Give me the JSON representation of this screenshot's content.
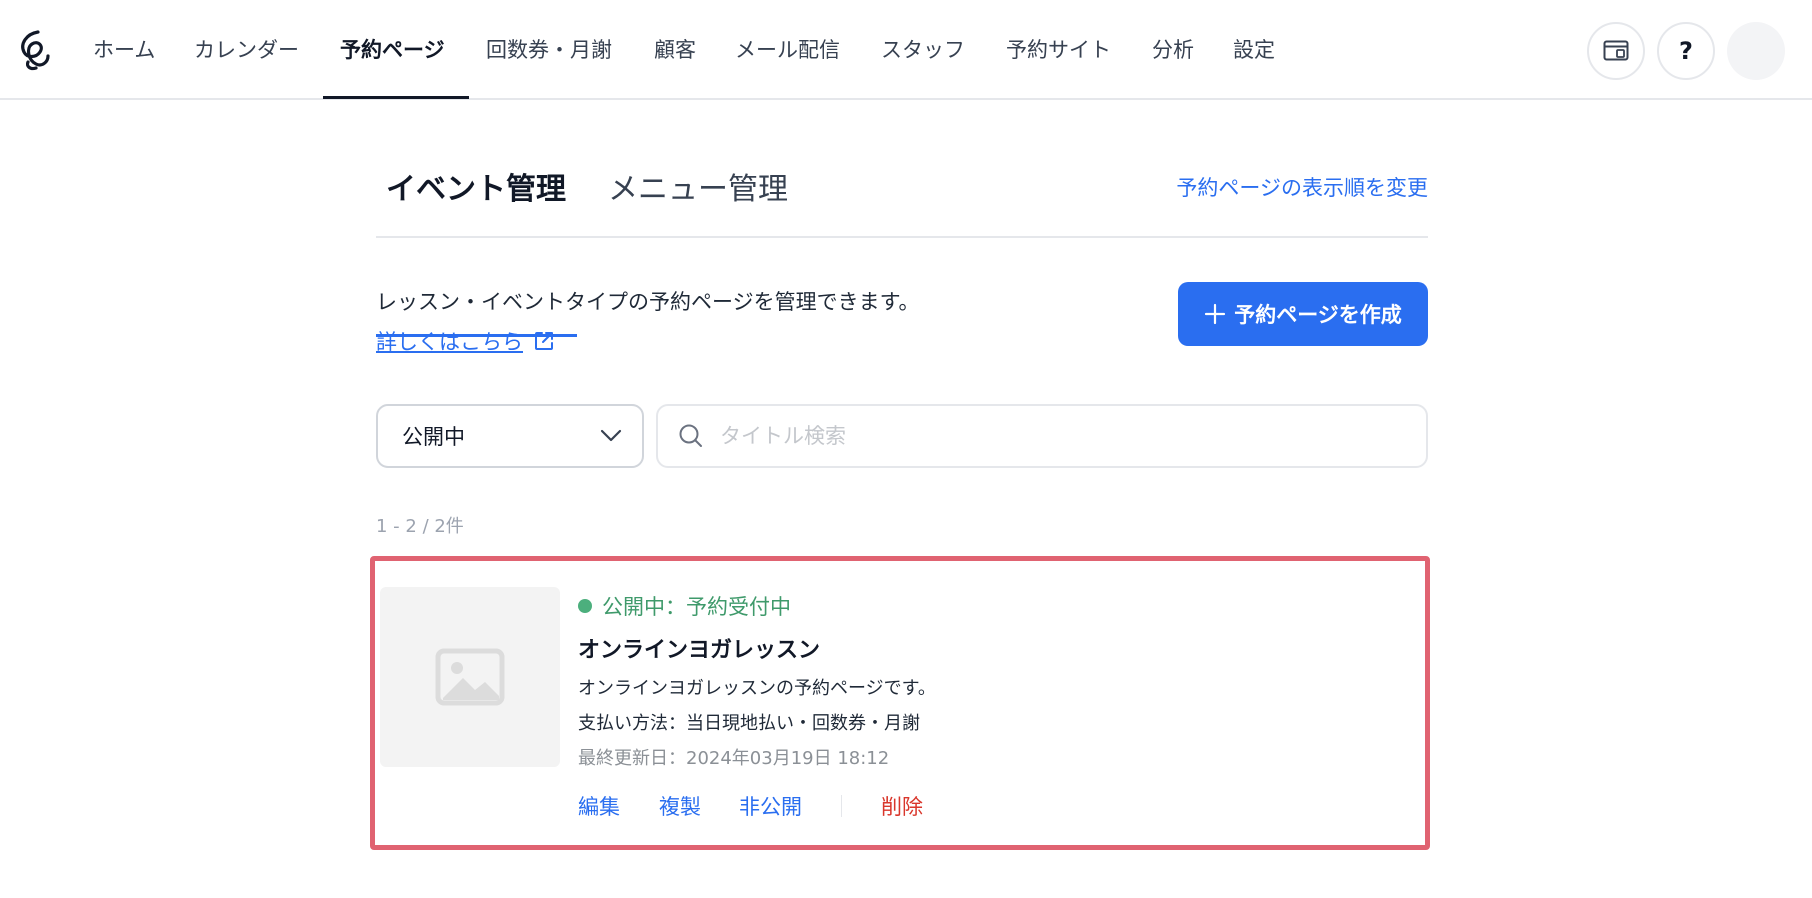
{
  "nav": {
    "items": [
      {
        "label": "ホーム"
      },
      {
        "label": "カレンダー"
      },
      {
        "label": "予約ページ",
        "active": true
      },
      {
        "label": "回数券・月謝"
      },
      {
        "label": "顧客"
      },
      {
        "label": "メール配信"
      },
      {
        "label": "スタッフ"
      },
      {
        "label": "予約サイト"
      },
      {
        "label": "分析"
      },
      {
        "label": "設定"
      }
    ],
    "help_label": "?"
  },
  "tabs": {
    "event": "イベント管理",
    "menu": "メニュー管理",
    "reorder_link": "予約ページの表示順を変更"
  },
  "intro": {
    "description": "レッスン・イベントタイプの予約ページを管理できます。",
    "more_link": "詳しくはこちら",
    "create_button": "予約ページを作成"
  },
  "filter": {
    "selected": "公開中",
    "search_placeholder": "タイトル検索",
    "search_value": ""
  },
  "results": {
    "count": "1 - 2 / 2件"
  },
  "card": {
    "status": "公開中：予約受付中",
    "title": "オンラインヨガレッスン",
    "description": "オンラインヨガレッスンの予約ページです。",
    "payment": "支払い方法：当日現地払い・回数券・月謝",
    "updated": "最終更新日：2024年03月19日 18:12",
    "actions": {
      "edit": "編集",
      "duplicate": "複製",
      "unpublish": "非公開",
      "delete": "削除"
    }
  },
  "colors": {
    "accent": "#2a6ef0",
    "status_green": "#3f9a6b",
    "danger": "#d9362b",
    "highlight_border": "#e06371"
  }
}
